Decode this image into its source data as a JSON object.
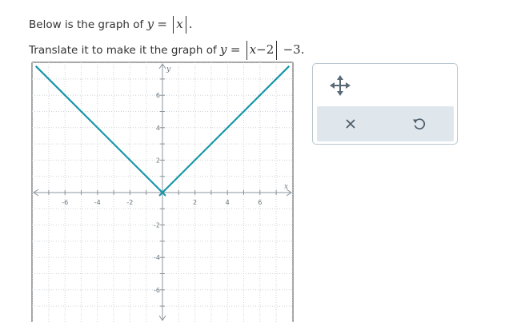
{
  "prompt": {
    "line1_text": "Below is the graph of",
    "line1_fn_var": "y",
    "line1_equals": "=",
    "line1_abs_inner": "x",
    "line1_period": ".",
    "line2_text": "Translate it to make it the graph of",
    "line2_fn_var": "y",
    "line2_equals": "=",
    "line2_abs_inner_var": "x",
    "line2_abs_inner_rest": "−2",
    "line2_tail": "−3."
  },
  "graph": {
    "x_axis_label": "x",
    "y_axis_label": "y",
    "x_tick_labels": [
      "-6",
      "-4",
      "-2",
      "2",
      "4",
      "6"
    ],
    "y_tick_labels": [
      "6",
      "4",
      "2",
      "-2",
      "-4",
      "-6"
    ],
    "grid": true,
    "line_color": "#1a96a8",
    "plotted_function": "y = |x|",
    "vertex": [
      0,
      0
    ],
    "left_endpoint": [
      -7.8,
      7.8
    ],
    "right_endpoint": [
      7.8,
      7.8
    ]
  },
  "tools": {
    "move_icon": "move-arrows-icon",
    "clear_icon": "close-x-icon",
    "undo_icon": "undo-icon"
  }
}
